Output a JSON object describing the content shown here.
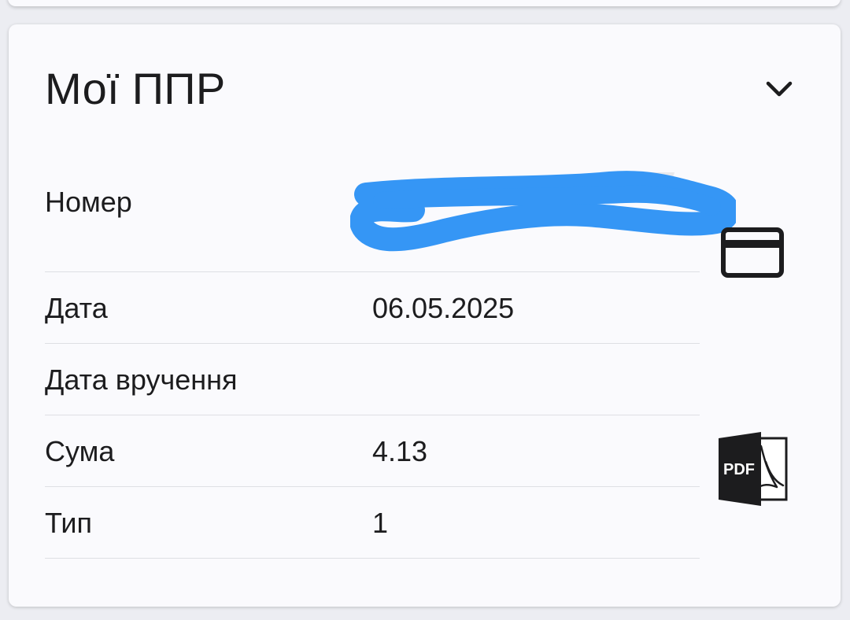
{
  "card": {
    "title": "Мої ППР",
    "rows": [
      {
        "label": "Номер",
        "value": ""
      },
      {
        "label": "Дата",
        "value": "06.05.2025"
      },
      {
        "label": "Дата вручення",
        "value": ""
      },
      {
        "label": "Сума",
        "value": "4.13"
      },
      {
        "label": "Тип",
        "value": "1"
      }
    ],
    "pdf_icon_text": "PDF"
  },
  "icons": {
    "collapse": "chevron-down-icon",
    "payment": "credit-card-icon",
    "download": "pdf-file-icon"
  },
  "colors": {
    "background": "#ecedf2",
    "card": "#fafafd",
    "text": "#1c1c1e",
    "divider": "#dedfe4",
    "redaction_scribble": "#3596f5"
  }
}
